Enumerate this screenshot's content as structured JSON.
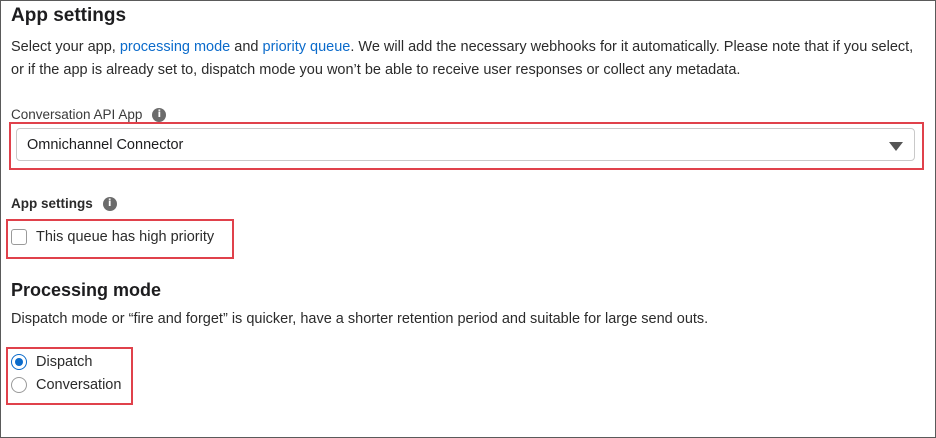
{
  "app_settings": {
    "title": "App settings",
    "description_prefix": "Select your app, ",
    "link_processing_mode": "processing mode",
    "description_and": " and ",
    "link_priority_queue": "priority queue",
    "description_suffix": ". We will add the necessary webhooks for it automatically. Please note that if you select, or if the app is already set to, dispatch mode you won’t be able to receive user responses or collect any metadata."
  },
  "conversation_api_app": {
    "label": "Conversation API App",
    "selected_value": "Omnichannel Connector"
  },
  "app_settings_field": {
    "label": "App settings",
    "checkbox_label": "This queue has high priority",
    "checked": false
  },
  "processing_mode": {
    "title": "Processing mode",
    "description": "Dispatch mode or “fire and forget” is quicker, have a shorter retention period and suitable for large send outs.",
    "options": [
      {
        "label": "Dispatch",
        "selected": true
      },
      {
        "label": "Conversation",
        "selected": false
      }
    ]
  },
  "icons": {
    "info": "info-icon",
    "dropdown": "caret-down-icon"
  },
  "colors": {
    "link": "#0b6bcb",
    "highlight_border": "#e0414b",
    "radio_selected": "#0b6bcb"
  }
}
